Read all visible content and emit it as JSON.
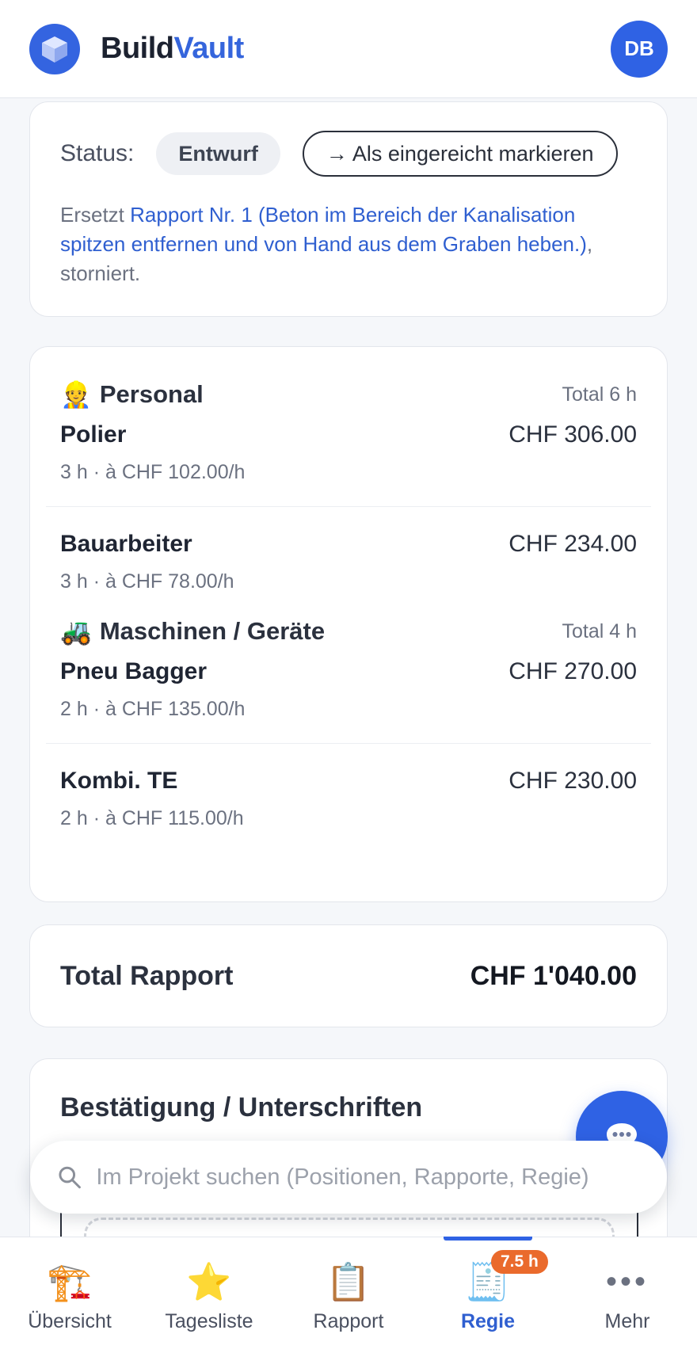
{
  "header": {
    "brand_part1": "Build",
    "brand_part2": "Vault",
    "avatar_initials": "DB",
    "logo_icon": "cube-icon",
    "brand_color": "#3464e0"
  },
  "status_card": {
    "status_label": "Status:",
    "status_value": "Entwurf",
    "mark_button": "→ Als eingereicht markieren",
    "replaces_prefix": "Ersetzt",
    "replaces_link": "Rapport Nr. 1 (Beton im Bereich der Kanalisation spitzen entfernen und von Hand aus dem Graben heben.)",
    "replaces_suffix": ", storniert."
  },
  "personal": {
    "icon": "👷",
    "title": "Personal",
    "total": "Total 6 h",
    "items": [
      {
        "name": "Polier",
        "price": "CHF 306.00",
        "detail": "3 h · à CHF 102.00/h"
      },
      {
        "name": "Bauarbeiter",
        "price": "CHF 234.00",
        "detail": "3 h · à CHF 78.00/h"
      }
    ]
  },
  "machines": {
    "icon": "🚜",
    "title": "Maschinen / Geräte",
    "total": "Total 4 h",
    "items": [
      {
        "name": "Pneu Bagger",
        "price": "CHF 270.00",
        "detail": "2 h · à CHF 135.00/h"
      },
      {
        "name": "Kombi. TE",
        "price": "CHF 230.00",
        "detail": "2 h · à CHF 115.00/h"
      }
    ]
  },
  "total": {
    "label": "Total Rapport",
    "value": "CHF 1'040.00"
  },
  "confirmation": {
    "title": "Bestätigung / Unterschriften"
  },
  "search": {
    "placeholder": "Im Projekt suchen (Positionen, Rapporte, Regie)"
  },
  "nav": {
    "items": [
      {
        "label": "Übersicht",
        "icon": "🏗️"
      },
      {
        "label": "Tagesliste",
        "icon": "⭐"
      },
      {
        "label": "Rapport",
        "icon": "📋"
      },
      {
        "label": "Regie",
        "icon": "🧾",
        "badge": "7.5 h",
        "active": true
      },
      {
        "label": "Mehr",
        "icon": "•••"
      }
    ]
  }
}
